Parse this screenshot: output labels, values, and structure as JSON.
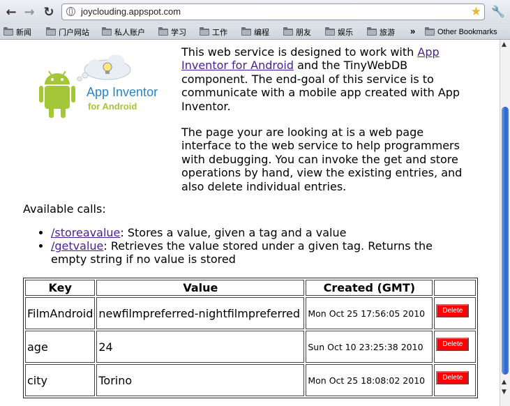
{
  "browser": {
    "back_icon": "back-arrow-icon",
    "forward_icon": "forward-arrow-icon",
    "reload_icon": "reload-icon",
    "url": "joyclouding.appspot.com",
    "bookmarks": [
      {
        "label": "新闻"
      },
      {
        "label": "门户网站"
      },
      {
        "label": "私人账户"
      },
      {
        "label": "学习"
      },
      {
        "label": "工作"
      },
      {
        "label": "编程"
      },
      {
        "label": "朋友"
      },
      {
        "label": "娱乐"
      },
      {
        "label": "旅游"
      }
    ],
    "overflow_label": "»",
    "other_bookmarks": "Other Bookmarks"
  },
  "logo": {
    "line1": "App Inventor",
    "line2": "for Android"
  },
  "intro": {
    "p1_before": "This web service is designed to work with ",
    "p1_link": "App Inventor for Android",
    "p1_after": " and the TinyWebDB component. The end-goal of this service is to communicate with a mobile app created with App Inventor.",
    "p2": "The page your are looking at is a web page interface to the web service to help programmers with debugging. You can invoke the get and store operations by hand, view the existing entries, and also delete individual entries."
  },
  "calls_title": "Available calls:",
  "calls": [
    {
      "link": "/storeavalue",
      "desc": ": Stores a value, given a tag and a value"
    },
    {
      "link": "/getvalue",
      "desc": ": Retrieves the value stored under a given tag. Returns the empty string if no value is stored"
    }
  ],
  "table": {
    "headers": [
      "Key",
      "Value",
      "Created (GMT)",
      ""
    ],
    "rows": [
      {
        "key": "FilmAndroid",
        "value": "newfilmpreferred-nightfilmpreferred",
        "created": "Mon Oct 25 17:56:05 2010",
        "action": "Delete"
      },
      {
        "key": "age",
        "value": "24",
        "created": "Sun Oct 10 23:25:38 2010",
        "action": "Delete"
      },
      {
        "key": "city",
        "value": "Torino",
        "created": "Mon Oct 25 18:08:02 2010",
        "action": "Delete"
      }
    ]
  },
  "colors": {
    "link": "#4a1f8f",
    "delete_button": "#ff0000",
    "android_green": "#a4c639",
    "logo_blue": "#2a83c8",
    "scroll_thumb": "#2a62c9"
  }
}
